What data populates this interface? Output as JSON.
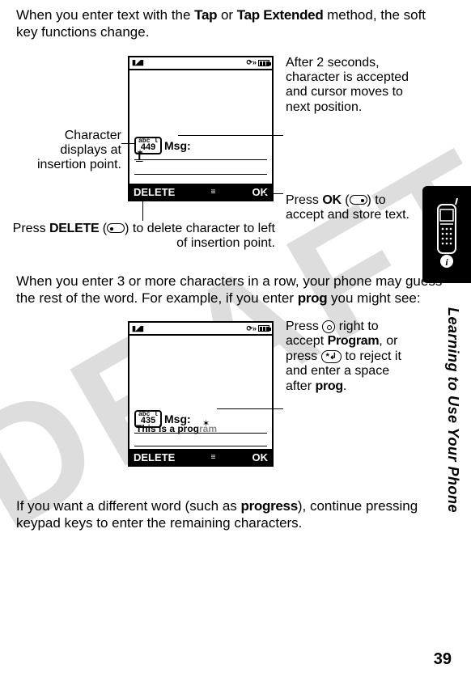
{
  "intro": {
    "p1a": "When you enter text with the ",
    "tap": "Tap",
    "p1b": " or ",
    "tapext": "Tap Extended",
    "p1c": " method, the soft key functions change."
  },
  "fig1": {
    "badge_abc": "abc l",
    "badge_count": "449",
    "msg": "Msg:",
    "char": "T",
    "soft_left": "DELETE",
    "soft_mid": "≡",
    "soft_right": "OK",
    "callout_tr": "After 2 seconds, character is accepted and cursor moves to next position.",
    "callout_br_a": "Press ",
    "callout_br_ok": "OK",
    "callout_br_b": " (",
    "callout_br_c": ") to accept and store text.",
    "callout_l1": "Character displays at insertion point.",
    "callout_l2_a": "Press ",
    "callout_l2_del": "DELETE",
    "callout_l2_b": " (",
    "callout_l2_c": ") to delete character to left of insertion point."
  },
  "mid": {
    "p2a": "When you enter 3 or more characters in a row, your phone may guess the rest of the word. For example, if you enter ",
    "prog": "prog",
    "p2b": " you might see:"
  },
  "fig2": {
    "badge_abc": "abc l",
    "badge_count": "435",
    "msg": "Msg:",
    "typed": "This is a prog",
    "suggest": "ram",
    "soft_left": "DELETE",
    "soft_mid": "≡",
    "soft_right": "OK",
    "callout_a": "Press ",
    "callout_b": " right to accept ",
    "prog_word": "Program",
    "callout_c": ", or press ",
    "key_star": "*↲",
    "callout_d": " to reject it and enter a space after ",
    "prog2": "prog",
    "callout_e": "."
  },
  "outro": {
    "p3a": "If you want a different word (such as ",
    "progress": "progress",
    "p3b": "), continue pressing keypad keys to enter the remaining characters."
  },
  "side": "Learning to Use Your Phone",
  "page": "39"
}
